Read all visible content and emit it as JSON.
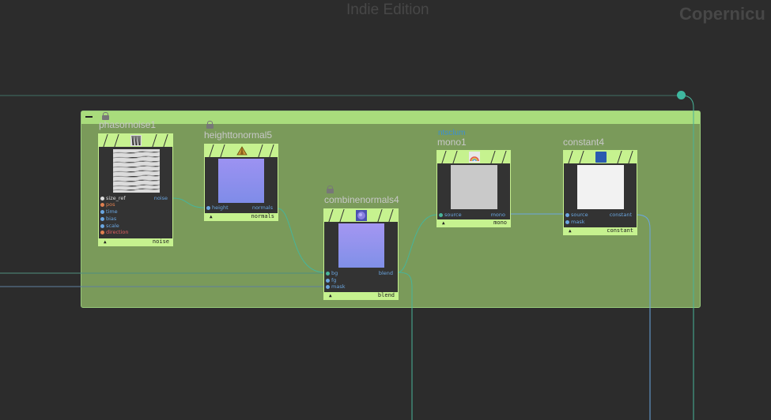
{
  "watermark": "Indie Edition",
  "context_label": "Copernicu",
  "colors": {
    "background": "#2c2c2c",
    "network_box": "#7a9a5a",
    "node_accent": "#c6f28f",
    "wire": "#48b49a",
    "port_label": "#6aa6e0"
  },
  "nodes": {
    "phasornoise": {
      "name": "phasornoise1",
      "footer": "noise",
      "inputs": [
        "size_ref",
        "pos",
        "time",
        "bias",
        "scale",
        "direction"
      ],
      "output": "noise"
    },
    "heighttonormal": {
      "name": "heighttonormal5",
      "footer": "normals",
      "input": "height",
      "output": "normals"
    },
    "combinenormals": {
      "name": "combinenormals4",
      "footer": "blend",
      "inputs": [
        "bg",
        "fg",
        "mask"
      ],
      "output": "blend"
    },
    "mono": {
      "tag": "ntsclum",
      "name": "mono1",
      "footer": "mono",
      "input": "source",
      "output": "mono"
    },
    "constant": {
      "name": "constant4",
      "footer": "constant",
      "inputs": [
        "source",
        "mask"
      ],
      "output": "constant"
    }
  },
  "icons": {
    "phasornoise": "barcode-noise-icon",
    "heighttonormal": "pyramid-icon",
    "combinenormals": "normal-sphere-icon",
    "mono": "rainbow-icon",
    "constant": "blue-square-icon"
  }
}
